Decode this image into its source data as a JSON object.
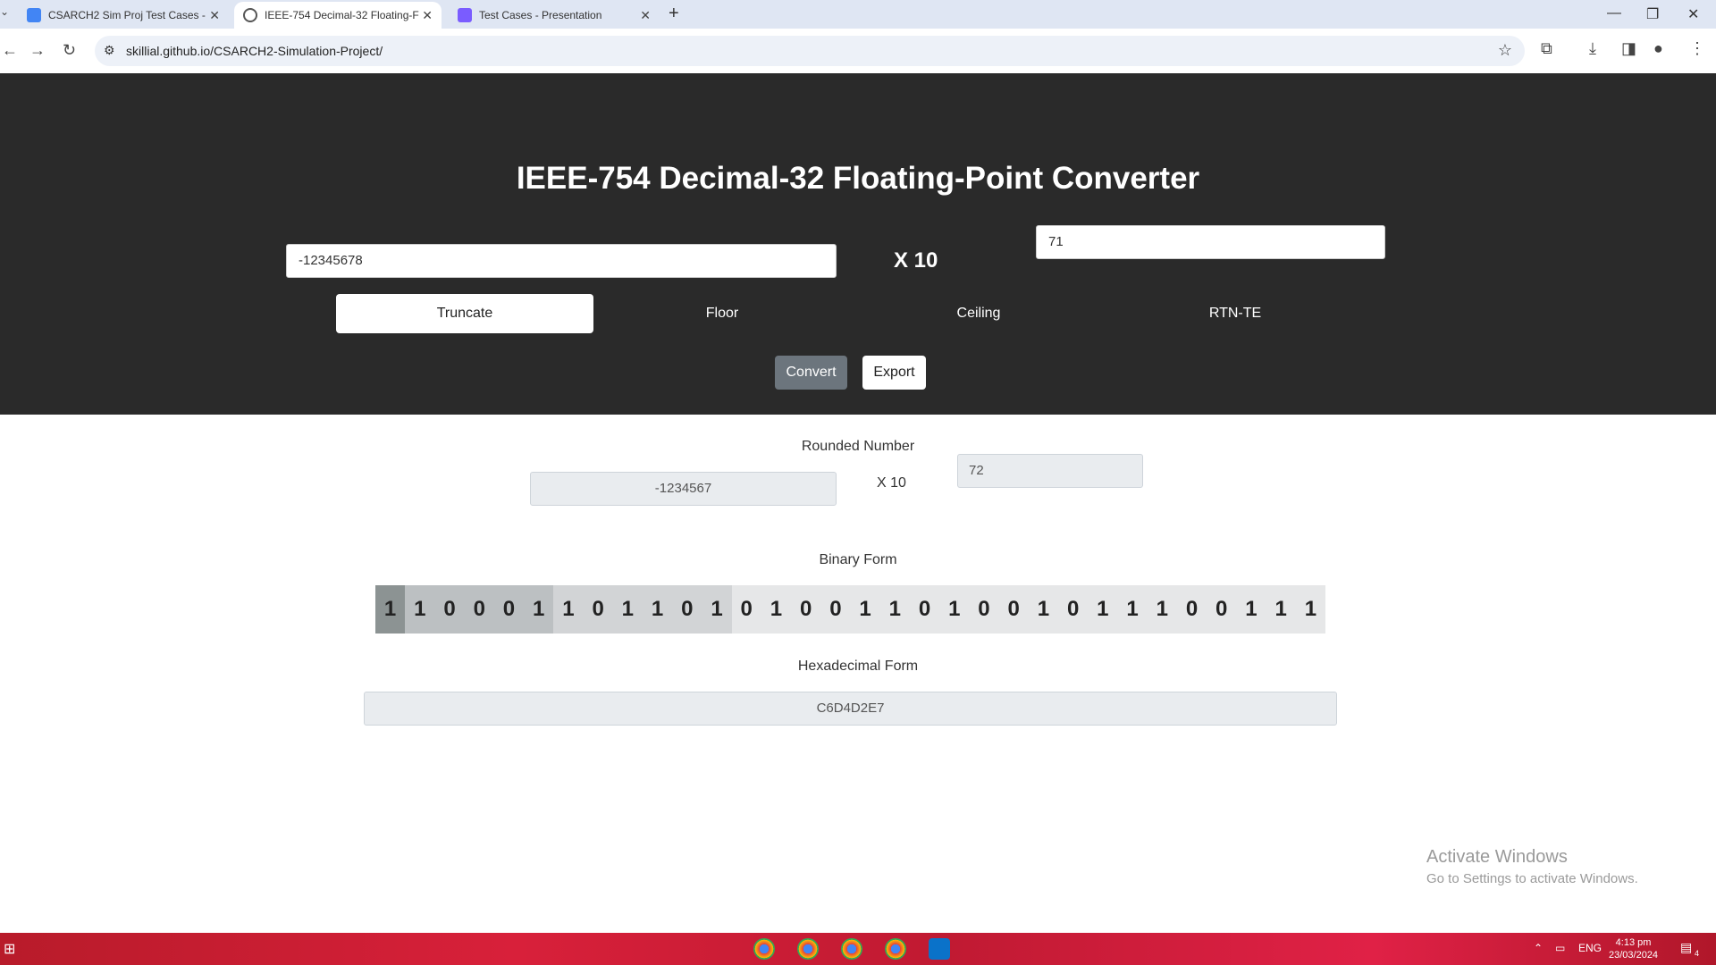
{
  "browser": {
    "tabs": [
      {
        "title": "CSARCH2 Sim Proj Test Cases -",
        "icon": "docs-icon"
      },
      {
        "title": "IEEE-754 Decimal-32 Floating-F",
        "icon": "globe-icon"
      },
      {
        "title": "Test Cases - Presentation",
        "icon": "slides-icon"
      }
    ],
    "url": "skillial.github.io/CSARCH2-Simulation-Project/"
  },
  "app": {
    "title": "IEEE-754 Decimal-32 Floating-Point Converter",
    "significand_value": "-12345678",
    "times_ten": "X 10",
    "exponent_value": "71",
    "rounding_modes": [
      "Truncate",
      "Floor",
      "Ceiling",
      "RTN-TE"
    ],
    "selected_mode": "Truncate",
    "convert_label": "Convert",
    "export_label": "Export"
  },
  "result": {
    "rounded_label": "Rounded Number",
    "rounded_significand": "-1234567",
    "times_ten": "X 10",
    "rounded_exponent": "72",
    "binary_label": "Binary Form",
    "bits": [
      "1",
      "1",
      "0",
      "0",
      "0",
      "1",
      "1",
      "0",
      "1",
      "1",
      "0",
      "1",
      "0",
      "1",
      "0",
      "0",
      "1",
      "1",
      "0",
      "1",
      "0",
      "0",
      "1",
      "0",
      "1",
      "1",
      "1",
      "0",
      "0",
      "1",
      "1",
      "1"
    ],
    "hex_label": "Hexadecimal Form",
    "hex_value": "C6D4D2E7"
  },
  "watermark": {
    "line1": "Activate Windows",
    "line2": "Go to Settings to activate Windows."
  },
  "taskbar": {
    "lang": "ENG",
    "time": "4:13 pm",
    "date": "23/03/2024",
    "notifications": "4"
  },
  "colors": {
    "hero_bg": "#2a2a2a",
    "sign_bit": "#8c9393",
    "combination_bits": "#bcc0c2",
    "exponent_continuation_bits": "#d2d4d6",
    "coefficient_bits": "#e6e7e8"
  }
}
